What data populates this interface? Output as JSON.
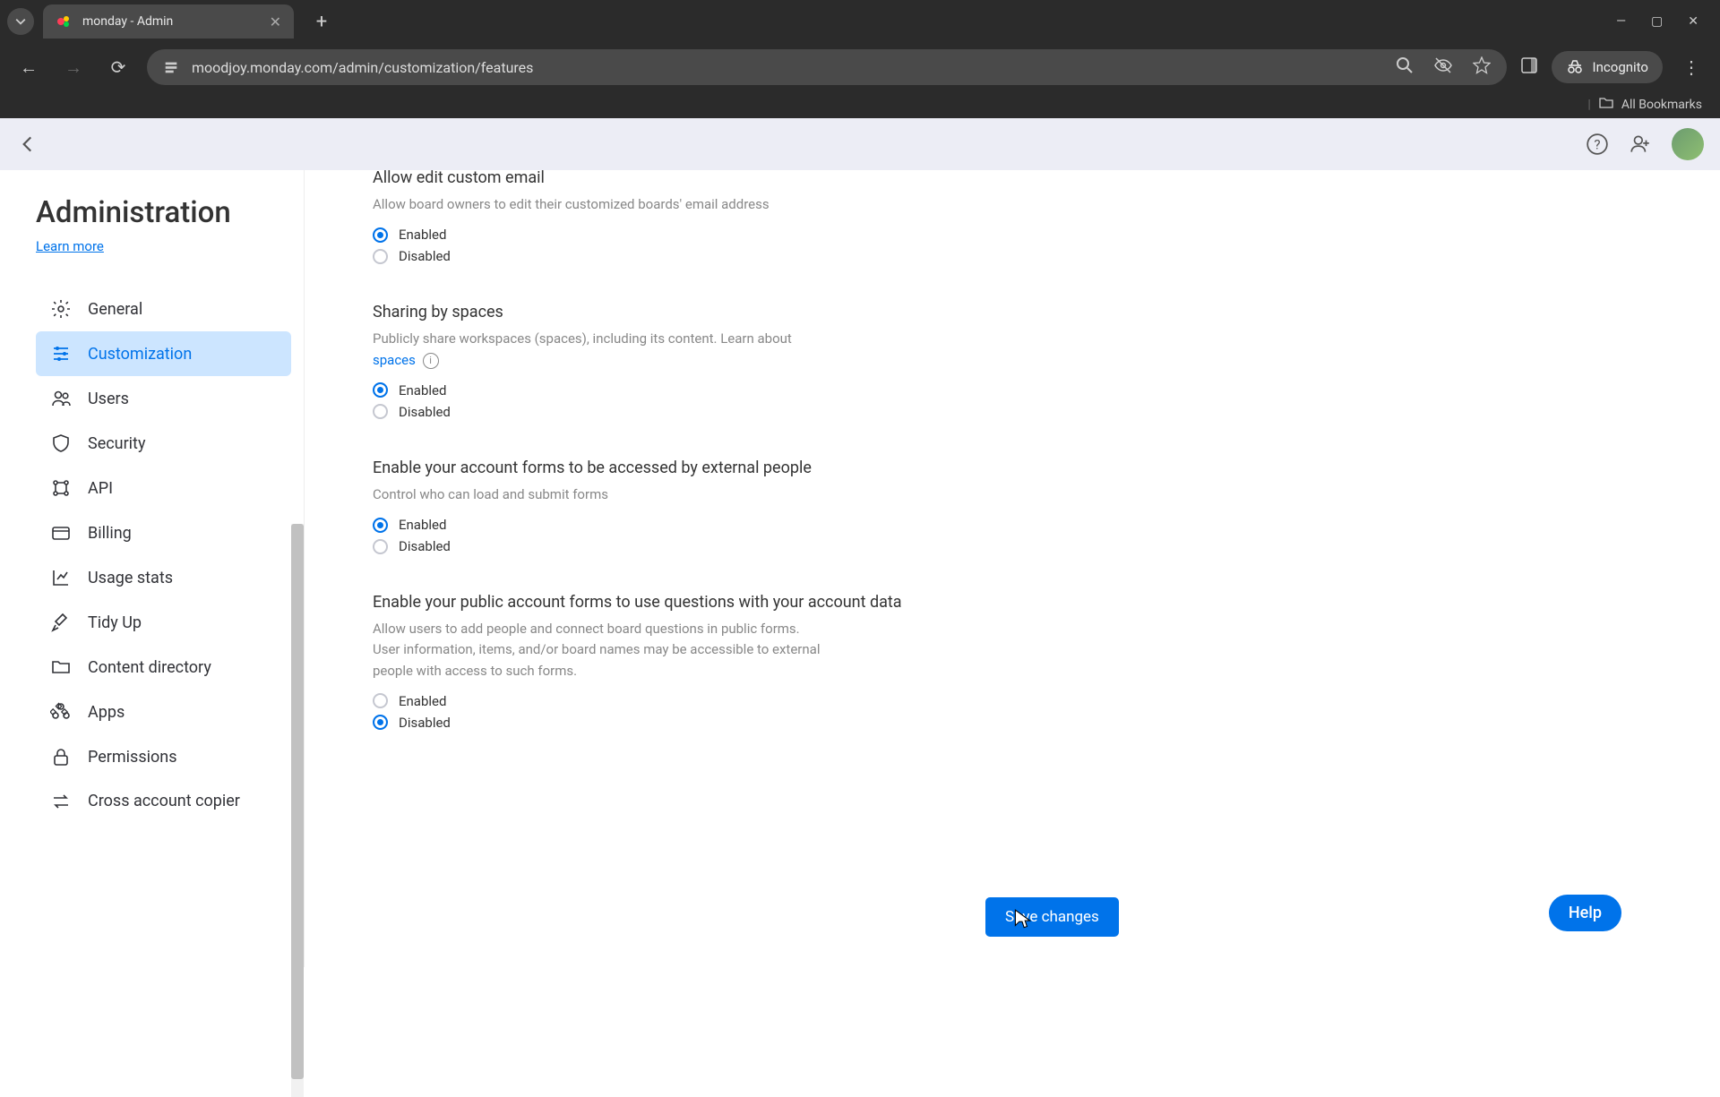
{
  "browser": {
    "tab_title": "monday - Admin",
    "url": "moodjoy.monday.com/admin/customization/features",
    "incognito_label": "Incognito",
    "all_bookmarks": "All Bookmarks"
  },
  "sidebar": {
    "title": "Administration",
    "learn_more": "Learn more",
    "items": [
      {
        "label": "General"
      },
      {
        "label": "Customization"
      },
      {
        "label": "Users"
      },
      {
        "label": "Security"
      },
      {
        "label": "API"
      },
      {
        "label": "Billing"
      },
      {
        "label": "Usage stats"
      },
      {
        "label": "Tidy Up"
      },
      {
        "label": "Content directory"
      },
      {
        "label": "Apps"
      },
      {
        "label": "Permissions"
      },
      {
        "label": "Cross account copier"
      }
    ]
  },
  "settings": {
    "s1": {
      "title": "Allow edit custom email",
      "desc": "Allow board owners to edit their customized boards' email address",
      "opt_en": "Enabled",
      "opt_dis": "Disabled",
      "selected": "enabled"
    },
    "s2": {
      "title": "Sharing by spaces",
      "desc_pre": "Publicly share workspaces (spaces), including its content. Learn about ",
      "link": "spaces",
      "opt_en": "Enabled",
      "opt_dis": "Disabled",
      "selected": "enabled"
    },
    "s3": {
      "title": "Enable your account forms to be accessed by external people",
      "desc": "Control who can load and submit forms",
      "opt_en": "Enabled",
      "opt_dis": "Disabled",
      "selected": "enabled"
    },
    "s4": {
      "title": "Enable your public account forms to use questions with your account data",
      "desc": "Allow users to add people and connect board questions in public forms. User information, items, and/or board names may be accessible to external people with access to such forms.",
      "opt_en": "Enabled",
      "opt_dis": "Disabled",
      "selected": "disabled"
    }
  },
  "buttons": {
    "save": "Save changes",
    "help": "Help"
  }
}
